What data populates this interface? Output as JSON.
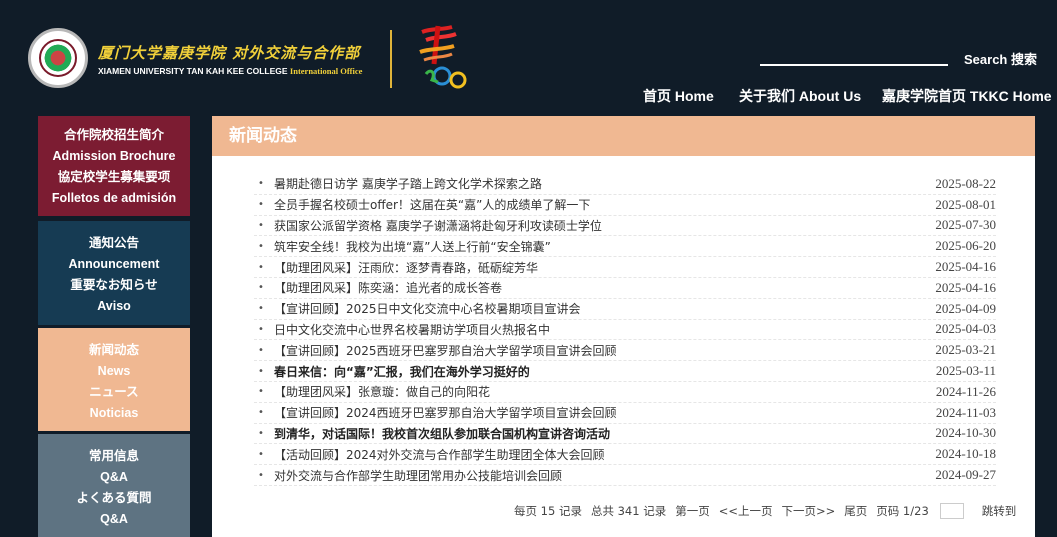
{
  "header": {
    "brand_cn": "厦门大学嘉庚学院 对外交流与合作部",
    "brand_en": "XIAMEN UNIVERSITY TAN KAH KEE COLLEGE",
    "brand_en_suffix": "International Office",
    "search_label": "Search 搜索",
    "nav": [
      "首页 Home",
      "关于我们 About Us",
      "嘉庚学院首页 TKKC Home"
    ]
  },
  "sidebar": [
    {
      "lines": [
        "合作院校招生简介",
        "Admission Brochure",
        "協定校学生募集要项",
        "Folletos de admisión"
      ],
      "color": "#7c1c32"
    },
    {
      "lines": [
        "通知公告",
        "Announcement",
        "重要なお知らせ",
        "Aviso"
      ],
      "color": "#163b53"
    },
    {
      "lines": [
        "新闻动态",
        "News",
        "ニュース",
        "Noticias"
      ],
      "color": "#f0b892"
    },
    {
      "lines": [
        "常用信息",
        "Q&A",
        "よくある質問",
        "Q&A"
      ],
      "color": "#5e7382"
    }
  ],
  "panel": {
    "title": "新闻动态"
  },
  "news": [
    {
      "title": "暑期赴德日访学 嘉庚学子踏上跨文化学术探索之路",
      "date": "2025-08-22",
      "bold": false
    },
    {
      "title": "全员手握名校硕士offer！这届在英“嘉”人的成绩单了解一下",
      "date": "2025-08-01",
      "bold": false
    },
    {
      "title": "获国家公派留学资格 嘉庚学子谢潇涵将赴匈牙利攻读硕士学位",
      "date": "2025-07-30",
      "bold": false
    },
    {
      "title": "筑牢安全线！我校为出境“嘉”人送上行前“安全锦囊”",
      "date": "2025-06-20",
      "bold": false
    },
    {
      "title": "【助理团风采】汪雨欣：逐梦青春路，砥砺绽芳华",
      "date": "2025-04-16",
      "bold": false
    },
    {
      "title": "【助理团风采】陈奕涵：追光者的成长答卷",
      "date": "2025-04-16",
      "bold": false
    },
    {
      "title": "【宣讲回顾】2025日中文化交流中心名校暑期项目宣讲会",
      "date": "2025-04-09",
      "bold": false
    },
    {
      "title": "日中文化交流中心世界名校暑期访学项目火热报名中",
      "date": "2025-04-03",
      "bold": false
    },
    {
      "title": "【宣讲回顾】2025西班牙巴塞罗那自治大学留学项目宣讲会回顾",
      "date": "2025-03-21",
      "bold": false
    },
    {
      "title": "春日来信：向“嘉”汇报，我们在海外学习挺好的",
      "date": "2025-03-11",
      "bold": true
    },
    {
      "title": "【助理团风采】张意璇：做自己的向阳花",
      "date": "2024-11-26",
      "bold": false
    },
    {
      "title": "【宣讲回顾】2024西班牙巴塞罗那自治大学留学项目宣讲会回顾",
      "date": "2024-11-03",
      "bold": false
    },
    {
      "title": "到清华，对话国际！我校首次组队参加联合国机构宣讲咨询活动",
      "date": "2024-10-30",
      "bold": true
    },
    {
      "title": "【活动回顾】2024对外交流与合作部学生助理团全体大会回顾",
      "date": "2024-10-18",
      "bold": false
    },
    {
      "title": "对外交流与合作部学生助理团常用办公技能培训会回顾",
      "date": "2024-09-27",
      "bold": false
    }
  ],
  "pager": {
    "per_page": "每页 15 记录",
    "total": "总共 341 记录",
    "first": "第一页",
    "prev": "<<上一页",
    "next": "下一页>>",
    "last": "尾页",
    "page": "页码 1/23",
    "goto": "跳转到"
  }
}
